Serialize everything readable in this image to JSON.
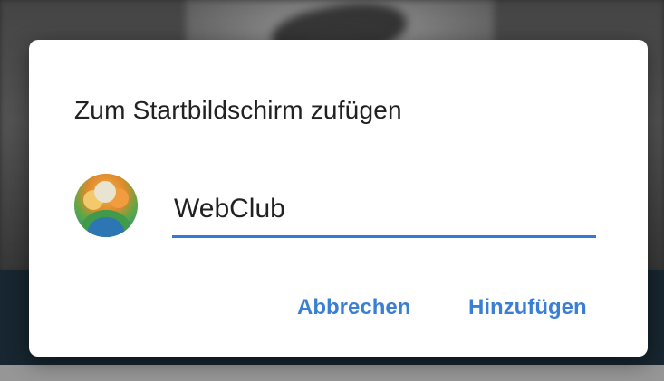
{
  "dialog": {
    "title": "Zum Startbildschirm zufügen",
    "app_name_value": "WebClub",
    "app_icon": "webclub-app-icon",
    "cancel_label": "Abbrechen",
    "add_label": "Hinzufügen"
  },
  "colors": {
    "accent": "#3b7fd4",
    "underline": "#2f7ad8",
    "title_text": "#212121",
    "dialog_bg": "#ffffff"
  }
}
